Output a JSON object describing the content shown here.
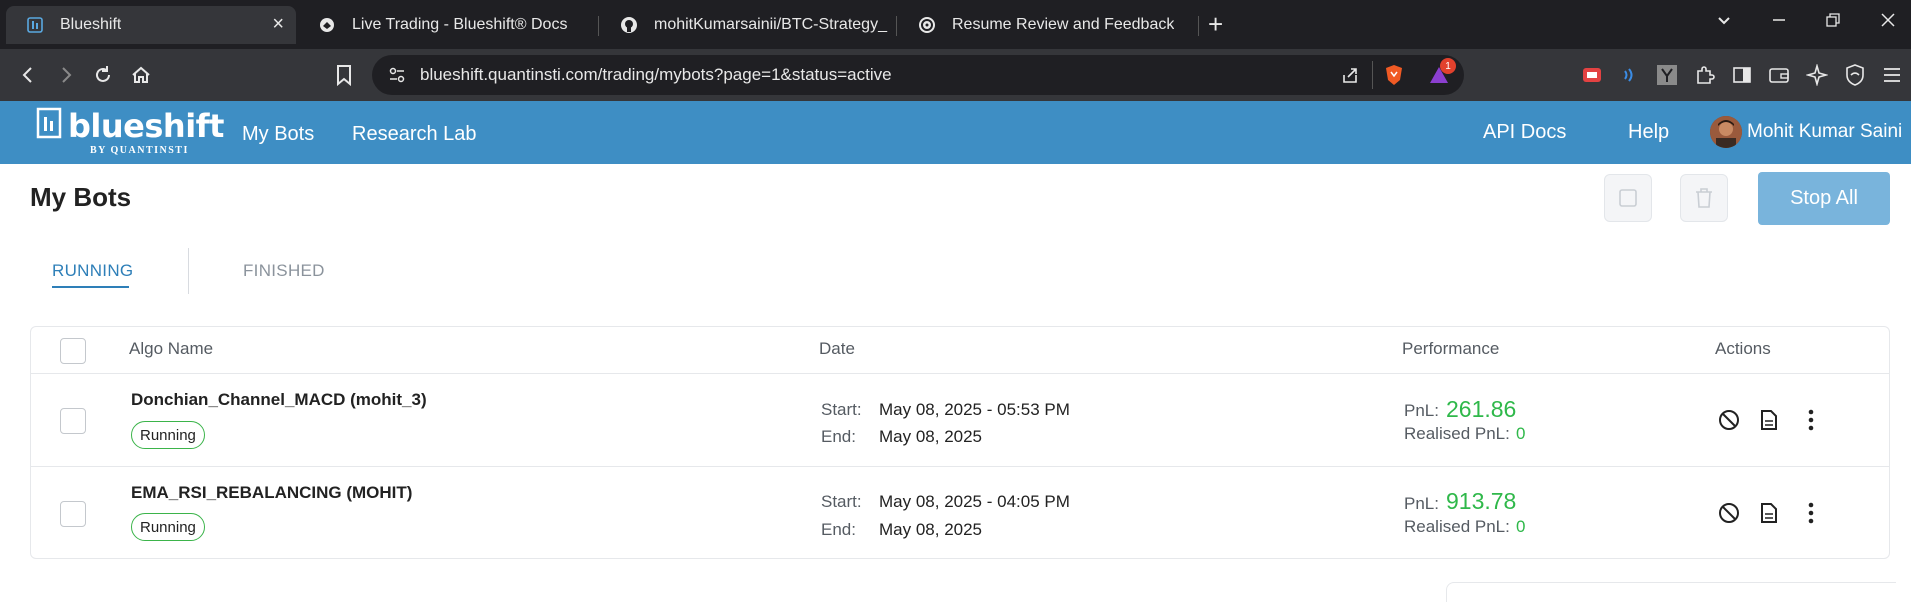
{
  "browser": {
    "tabs": [
      {
        "title": "Blueshift",
        "favicon": "blueshift-icon",
        "active": true
      },
      {
        "title": "Live Trading - Blueshift® Docs",
        "favicon": "docs-icon",
        "active": false
      },
      {
        "title": "mohitKumarsainii/BTC-Strategy_usin",
        "favicon": "github-icon",
        "active": false
      },
      {
        "title": "Resume Review and Feedback",
        "favicon": "openai-icon",
        "active": false
      }
    ],
    "url": "blueshift.quantinsti.com/trading/mybots?page=1&status=active",
    "extension_badge": "1",
    "new_tab": "+",
    "close_glyph": "×"
  },
  "header": {
    "logo_text": "blueshift",
    "logo_byline": "BY QUANTINSTI",
    "nav": [
      {
        "label": "My Bots"
      },
      {
        "label": "Research Lab"
      }
    ],
    "right_links": [
      {
        "label": "API Docs"
      },
      {
        "label": "Help"
      }
    ],
    "user_name": "Mohit Kumar Saini",
    "accent": "#3e8ec4"
  },
  "page": {
    "title": "My Bots",
    "stop_all_label": "Stop All",
    "tabs": [
      {
        "label": "RUNNING"
      },
      {
        "label": "FINISHED"
      }
    ]
  },
  "table": {
    "headers": {
      "algo": "Algo Name",
      "date": "Date",
      "performance": "Performance",
      "actions": "Actions"
    },
    "start_label": "Start:",
    "end_label": "End:",
    "pnl_label": "PnL:",
    "realised_label": "Realised PnL:",
    "rows": [
      {
        "name": "Donchian_Channel_MACD (mohit_3)",
        "status": "Running",
        "start": "May 08, 2025 - 05:53 PM",
        "end": "May 08, 2025",
        "pnl": "261.86",
        "realised_pnl": "0"
      },
      {
        "name": "EMA_RSI_REBALANCING (MOHIT)",
        "status": "Running",
        "start": "May 08, 2025 - 04:05 PM",
        "end": "May 08, 2025",
        "pnl": "913.78",
        "realised_pnl": "0"
      }
    ],
    "pnl_color": "#2fb84a"
  }
}
